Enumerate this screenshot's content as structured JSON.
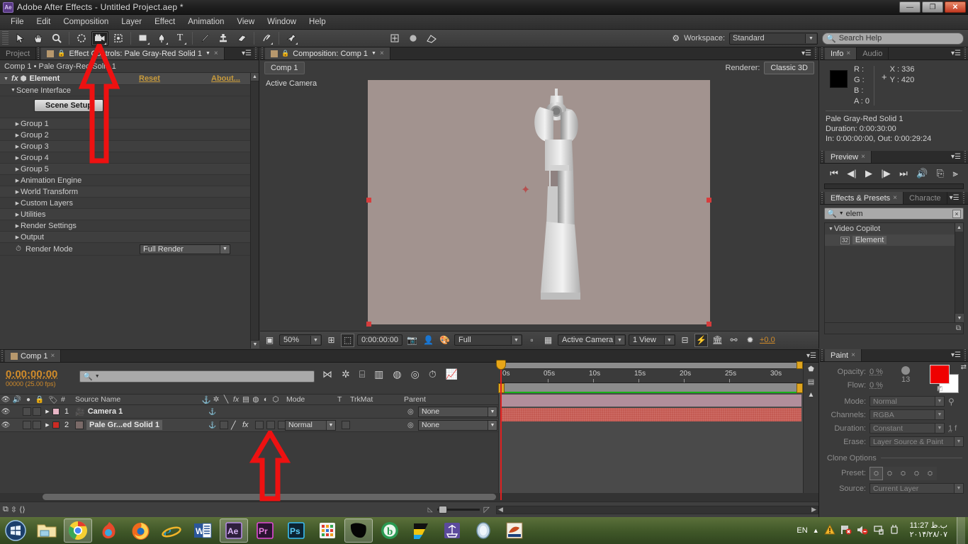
{
  "window": {
    "title": "Adobe After Effects - Untitled Project.aep *",
    "app_badge": "Ae",
    "minimize": "—",
    "maximize": "❐",
    "close": "✕"
  },
  "menubar": [
    "File",
    "Edit",
    "Composition",
    "Layer",
    "Effect",
    "Animation",
    "View",
    "Window",
    "Help"
  ],
  "toolbar": {
    "tools": [
      {
        "name": "selection-tool",
        "glyph": "➤",
        "active": false
      },
      {
        "name": "hand-tool",
        "glyph": "✋",
        "active": false
      },
      {
        "name": "zoom-tool",
        "glyph": "🔍",
        "active": false
      },
      {
        "name": "rotation-tool",
        "glyph": "◌",
        "active": false
      },
      {
        "name": "camera-tool",
        "glyph": "🎥",
        "active": true
      },
      {
        "name": "pan-behind-tool",
        "glyph": "❖",
        "active": false
      },
      {
        "name": "shape-tool",
        "glyph": "▢",
        "active": false
      },
      {
        "name": "pen-tool",
        "glyph": "✒",
        "active": false
      },
      {
        "name": "type-tool",
        "glyph": "T",
        "active": false
      },
      {
        "name": "brush-tool",
        "glyph": "🖌",
        "active": false
      },
      {
        "name": "clone-stamp-tool",
        "glyph": "⚒",
        "active": false
      },
      {
        "name": "eraser-tool",
        "glyph": "▱",
        "active": false
      },
      {
        "name": "roto-brush-tool",
        "glyph": "✎",
        "active": false
      },
      {
        "name": "puppet-pin-tool",
        "glyph": "📌",
        "active": false
      }
    ],
    "workspace_label": "Workspace:",
    "workspace_value": "Standard",
    "search_help_placeholder": "Search Help"
  },
  "effect_controls": {
    "tab_project": "Project",
    "tab_title": "Effect Controls: Pale Gray-Red Solid 1",
    "subheader": "Comp 1 • Pale Gray-Red Solid 1",
    "effect_name": "Element",
    "reset": "Reset",
    "about": "About...",
    "scene_interface": "Scene Interface",
    "scene_setup_button": "Scene Setup",
    "groups": [
      "Group 1",
      "Group 2",
      "Group 3",
      "Group 4",
      "Group 5",
      "Animation Engine",
      "World Transform",
      "Custom Layers",
      "Utilities",
      "Render Settings",
      "Output"
    ],
    "render_mode_label": "Render Mode",
    "render_mode_value": "Full Render"
  },
  "composition": {
    "tab_title": "Composition: Comp 1",
    "breadcrumb": "Comp 1",
    "renderer_label": "Renderer:",
    "renderer_value": "Classic 3D",
    "view_label": "Active Camera",
    "footer": {
      "magnification": "50%",
      "timecode": "0:00:00:00",
      "resolution": "Full",
      "view_camera": "Active Camera",
      "view_count": "1 View",
      "exposure": "+0.0"
    }
  },
  "info": {
    "tab": "Info",
    "tab_audio": "Audio",
    "r": "R :",
    "g": "G :",
    "b": "B :",
    "a": "A : 0",
    "x": "X : 336",
    "y": "Y : 420",
    "layer_name": "Pale Gray-Red Solid 1",
    "duration": "Duration: 0:00:30:00",
    "inout": "In: 0:00:00:00, Out: 0:00:29:24"
  },
  "preview": {
    "tab": "Preview",
    "buttons": [
      "⏮",
      "◀|",
      "▶",
      "|▶",
      "⏭",
      "🔊",
      "⎘",
      "⫸"
    ]
  },
  "effects_presets": {
    "tab": "Effects & Presets",
    "tab_character": "Characte",
    "search_value": "elem",
    "category": "Video Copilot",
    "item": "Element",
    "item_badge": "32"
  },
  "paint": {
    "tab": "Paint",
    "opacity_label": "Opacity:",
    "opacity_value": "0 %",
    "flow_label": "Flow:",
    "flow_value": "0 %",
    "brush_size": "13",
    "mode_label": "Mode:",
    "mode_value": "Normal",
    "channels_label": "Channels:",
    "channels_value": "RGBA",
    "duration_label": "Duration:",
    "duration_value": "Constant",
    "duration_frames": "1",
    "duration_unit": "f",
    "erase_label": "Erase:",
    "erase_value": "Layer Source & Paint",
    "clone_options": "Clone Options",
    "preset_label": "Preset:",
    "source_label": "Source:",
    "source_value": "Current Layer",
    "foreground_color": "#ef0000",
    "background_color": "#ffffff"
  },
  "timeline": {
    "tab": "Comp 1",
    "current_time": "0:00:00:00",
    "frame_info": "00000 (25.00 fps)",
    "columns": [
      "#",
      "Source Name",
      "Mode",
      "T",
      "TrkMat",
      "Parent"
    ],
    "ruler_labels": [
      "0s",
      "05s",
      "10s",
      "15s",
      "20s",
      "25s",
      "30s"
    ],
    "layers": [
      {
        "index": "1",
        "name": "Camera 1",
        "label_color": "#e8b6c6",
        "mode": "",
        "parent": "None",
        "bar_color": "#b18e9b",
        "selected": false
      },
      {
        "index": "2",
        "name": "Pale Gr...ed Solid 1",
        "label_color": "#cc2b24",
        "mode": "Normal",
        "parent": "None",
        "bar_color": "#c45a52",
        "selected": true
      }
    ]
  },
  "taskbar": {
    "apps": [
      {
        "name": "start-button",
        "glyph": "⊞"
      },
      {
        "name": "file-explorer",
        "glyph": "🗂"
      },
      {
        "name": "google-chrome",
        "glyph": "◉"
      },
      {
        "name": "maxthon-browser",
        "glyph": "◑"
      },
      {
        "name": "mozilla-firefox",
        "glyph": "🦊"
      },
      {
        "name": "internet-explorer",
        "glyph": "e"
      },
      {
        "name": "microsoft-word",
        "glyph": "W"
      },
      {
        "name": "adobe-after-effects",
        "glyph": "Ae"
      },
      {
        "name": "adobe-premiere-pro",
        "glyph": "Pr"
      },
      {
        "name": "adobe-photoshop",
        "glyph": "Ps"
      },
      {
        "name": "calculator-app",
        "glyph": "▦"
      },
      {
        "name": "black-window-thumb",
        "glyph": "◼"
      },
      {
        "name": "bing-browser",
        "glyph": "b"
      },
      {
        "name": "colorful-flag-app",
        "glyph": "▰"
      },
      {
        "name": "ship-app",
        "glyph": "⛵"
      },
      {
        "name": "media-player",
        "glyph": "◯"
      },
      {
        "name": "persian-app",
        "glyph": "؟"
      }
    ],
    "language": "EN",
    "time": "11:27 ب.ظ",
    "date": "۲۰۱۴/۲۸/۰۷"
  }
}
